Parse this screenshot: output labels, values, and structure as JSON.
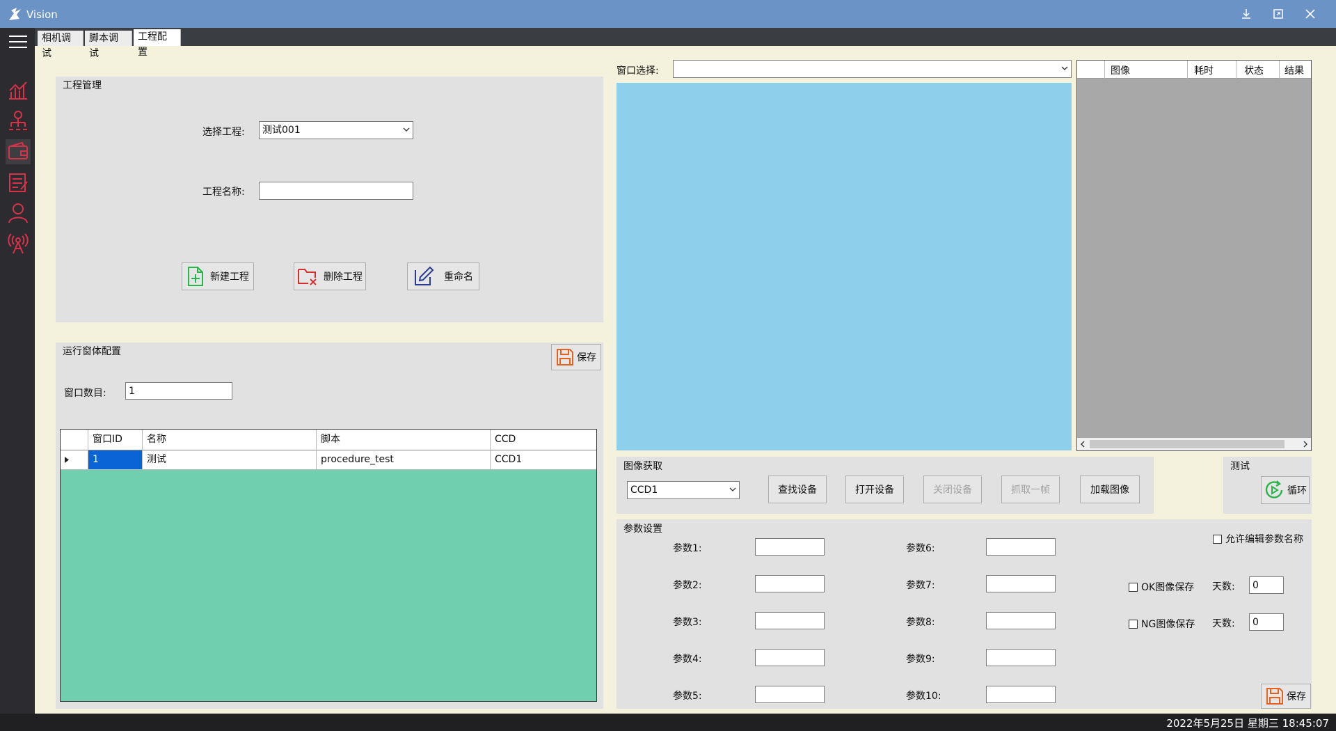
{
  "window": {
    "title": "Vision"
  },
  "tabs": [
    {
      "label": "相机调试"
    },
    {
      "label": "脚本调试"
    },
    {
      "label": "工程配置"
    }
  ],
  "project": {
    "title": "工程管理",
    "select_label": "选择工程:",
    "select_value": "测试001",
    "name_label": "工程名称:",
    "name_value": "",
    "new_button": "新建工程",
    "delete_button": "删除工程",
    "rename_button": "重命名"
  },
  "runtime": {
    "title": "运行窗体配置",
    "save_button": "保存",
    "window_count_label": "窗口数目:",
    "window_count_value": "1",
    "columns": [
      "窗口ID",
      "名称",
      "脚本",
      "CCD"
    ],
    "rows": [
      {
        "id": "1",
        "name": "测试",
        "script": "procedure_test",
        "ccd": "CCD1"
      }
    ]
  },
  "window_select": {
    "label": "窗口选择:",
    "value": ""
  },
  "result_table": {
    "columns": [
      "图像",
      "耗时",
      "状态",
      "结果"
    ]
  },
  "acquisition": {
    "title": "图像获取",
    "device_value": "CCD1",
    "find_button": "查找设备",
    "open_button": "打开设备",
    "close_button": "关闭设备",
    "grab_button": "抓取一帧",
    "load_button": "加载图像"
  },
  "test": {
    "title": "测试",
    "loop_button": "循环"
  },
  "params": {
    "title": "参数设置",
    "allow_edit_label": "允许编辑参数名称",
    "left": [
      {
        "label": "参数1:",
        "value": ""
      },
      {
        "label": "参数2:",
        "value": ""
      },
      {
        "label": "参数3:",
        "value": ""
      },
      {
        "label": "参数4:",
        "value": ""
      },
      {
        "label": "参数5:",
        "value": ""
      }
    ],
    "right": [
      {
        "label": "参数6:",
        "value": ""
      },
      {
        "label": "参数7:",
        "value": ""
      },
      {
        "label": "参数8:",
        "value": ""
      },
      {
        "label": "参数9:",
        "value": ""
      },
      {
        "label": "参数10:",
        "value": ""
      }
    ],
    "ok_save_label": "OK图像保存",
    "ng_save_label": "NG图像保存",
    "days_label": "天数:",
    "ok_days_value": "0",
    "ng_days_value": "0",
    "save_button": "保存"
  },
  "statusbar": {
    "datetime": "2022年5月25日 星期三  18:45:07"
  },
  "colors": {
    "titlebar": "#6b93c6",
    "sidebar": "#2c2c30",
    "image_view": "#8ecfec",
    "grid_background": "#70cfae",
    "selected_cell": "#0a64d6",
    "sidebar_icon": "#d8324a"
  },
  "icons": [
    "app-icon",
    "menu-icon",
    "chart-icon",
    "org-icon",
    "wallet-icon",
    "list-icon",
    "user-icon",
    "antenna-icon",
    "minimize-icon",
    "download-icon",
    "maximize-icon",
    "close-icon",
    "new-file-icon",
    "delete-folder-icon",
    "edit-icon",
    "save-icon",
    "loop-icon"
  ]
}
